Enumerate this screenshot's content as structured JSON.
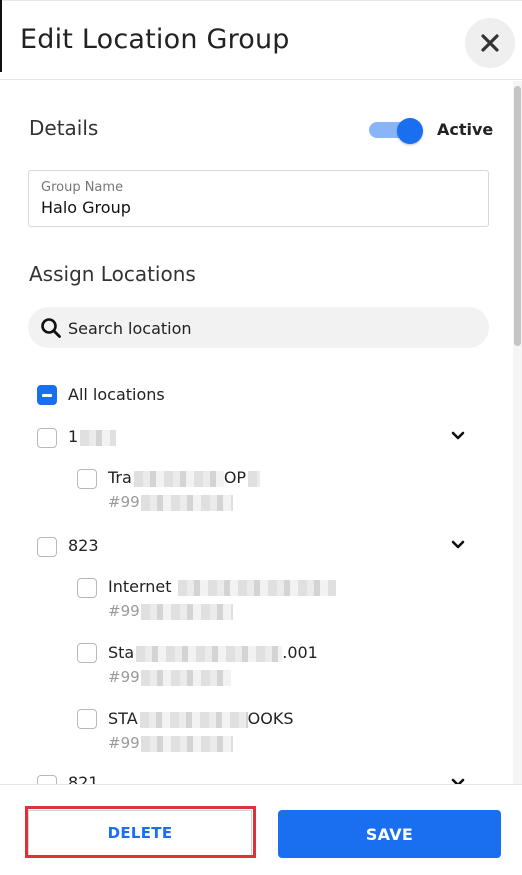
{
  "header": {
    "title": "Edit Location Group"
  },
  "details": {
    "title": "Details",
    "active_label": "Active",
    "active": true
  },
  "group_name": {
    "label": "Group Name",
    "value": "Halo Group"
  },
  "assign": {
    "title": "Assign Locations"
  },
  "search": {
    "placeholder": "Search location"
  },
  "all_locations": {
    "label": "All locations"
  },
  "groups": [
    {
      "code": "1",
      "locations": [
        {
          "name": "Tra",
          "name_suffix": "OP",
          "id": "#99"
        }
      ]
    },
    {
      "code": "823",
      "locations": [
        {
          "name": "Internet",
          "name_suffix": "",
          "id": "#99"
        },
        {
          "name": "Sta",
          "name_suffix": ".001",
          "id": "#99"
        },
        {
          "name": "STA",
          "name_suffix": "OOKS",
          "id": "#99"
        }
      ]
    },
    {
      "code": "821",
      "locations": []
    }
  ],
  "footer": {
    "delete_label": "DELETE",
    "save_label": "SAVE"
  },
  "colors": {
    "primary": "#1a6ef0",
    "highlight": "#e0303a"
  }
}
